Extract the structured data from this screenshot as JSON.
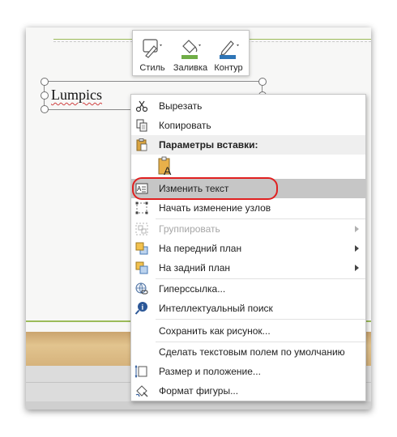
{
  "slide": {
    "textbox_text": "Lumpics"
  },
  "mini_toolbar": {
    "style_label": "Стиль",
    "fill_label": "Заливка",
    "outline_label": "Контур",
    "fill_color": "#70ad47",
    "outline_color": "#2e75b6"
  },
  "context_menu": {
    "cut": "Вырезать",
    "copy": "Копировать",
    "paste_options_header": "Параметры вставки:",
    "edit_text": "Изменить текст",
    "edit_points": "Начать изменение узлов",
    "group": "Группировать",
    "bring_forward": "На передний план",
    "send_backward": "На задний план",
    "hyperlink": "Гиперссылка...",
    "smart_lookup": "Интеллектуальный поиск",
    "save_as_picture": "Сохранить как рисунок...",
    "set_default_textbox": "Сделать текстовым полем по умолчанию",
    "size_position": "Размер и положение...",
    "format_shape": "Формат фигуры..."
  },
  "colors": {
    "highlight_outline": "#e02020",
    "slide_accent": "#9bbb59"
  }
}
